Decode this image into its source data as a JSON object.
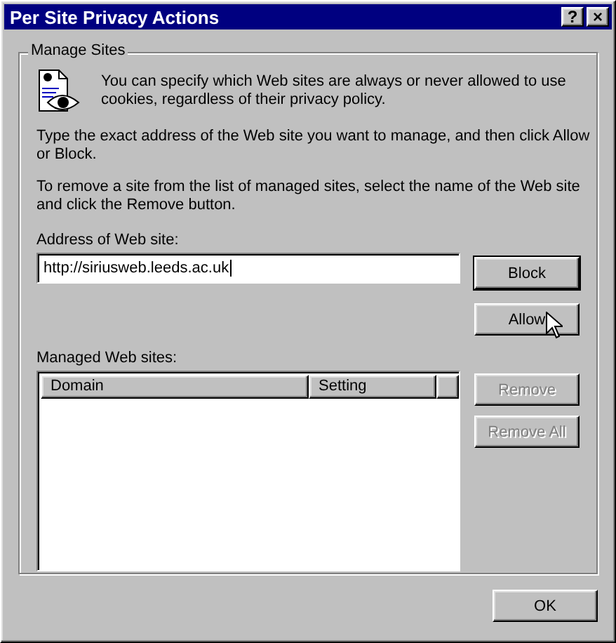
{
  "window": {
    "title": "Per Site Privacy Actions",
    "title_buttons": [
      "?",
      "×"
    ]
  },
  "group": {
    "title": "Manage Sites",
    "intro": "You can specify which Web sites are always or never allowed to use cookies, regardless of their privacy policy.",
    "instructions": [
      "Type the exact address of the Web site you want to manage, and then click Allow or Block.",
      "To remove a site from the list of managed sites, select the name of the Web site and click the Remove button."
    ],
    "address_label": "Address of Web site:",
    "address_value": "http://siriusweb.leeds.ac.uk",
    "list_label": "Managed Web sites:",
    "columns": [
      "Domain",
      "Setting"
    ],
    "buttons": [
      {
        "label": "Block",
        "disabled": false,
        "default": true
      },
      {
        "label": "Allow",
        "disabled": false,
        "default": false
      },
      {
        "label": "Remove",
        "disabled": true,
        "default": false
      },
      {
        "label": "Remove All",
        "disabled": true,
        "default": false
      }
    ]
  },
  "buttons": [
    {
      "label": "OK",
      "disabled": false,
      "default": false
    }
  ]
}
